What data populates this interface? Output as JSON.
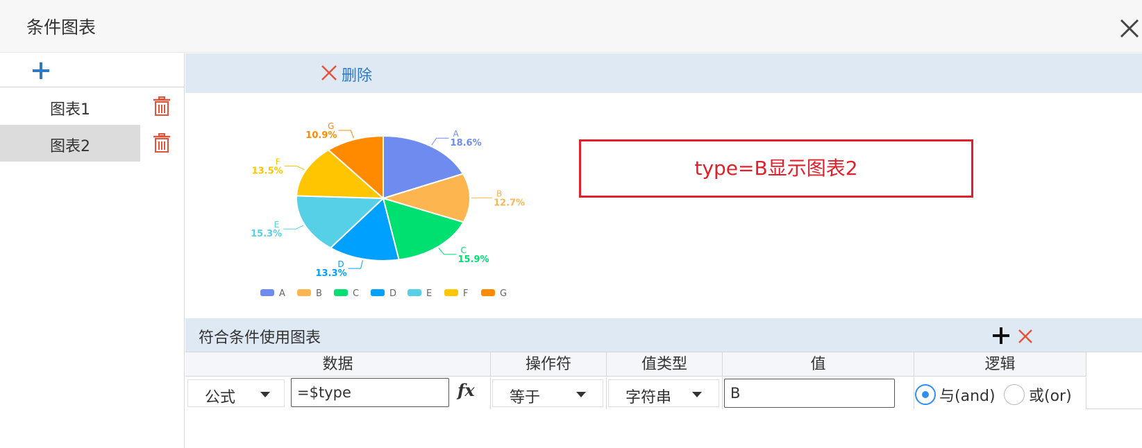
{
  "window": {
    "title": "条件图表"
  },
  "sidebar": {
    "items": [
      {
        "label": "图表1",
        "selected": false
      },
      {
        "label": "图表2",
        "selected": true
      }
    ]
  },
  "toolbar": {
    "delete_label": "删除"
  },
  "note": {
    "text": "type=B显示图表2"
  },
  "chart_data": {
    "type": "pie",
    "categories": [
      "A",
      "B",
      "C",
      "D",
      "E",
      "F",
      "G"
    ],
    "values": [
      18.6,
      12.7,
      15.9,
      13.3,
      15.3,
      13.5,
      10.9
    ],
    "labels": [
      "18.6%",
      "12.7%",
      "15.9%",
      "13.3%",
      "15.3%",
      "13.5%",
      "10.9%"
    ],
    "colors": [
      "#6e8cf0",
      "#fdb64f",
      "#00e070",
      "#00a0ff",
      "#55d0e6",
      "#ffc500",
      "#ff8a00"
    ],
    "legend_position": "bottom"
  },
  "conditions": {
    "title": "符合条件使用图表",
    "columns": [
      "数据",
      "操作符",
      "值类型",
      "值",
      "逻辑"
    ],
    "row": {
      "data_type": "公式",
      "data_value": "=$type",
      "operator": "等于",
      "value_type": "字符串",
      "value": "B",
      "logic_and": "与(and)",
      "logic_or": "或(or)",
      "logic_selected": "and"
    }
  },
  "icons": {
    "close": "close-icon",
    "add": "plus-icon",
    "trash": "trash-icon",
    "delete": "x-icon",
    "formula": "fx-icon",
    "caret": "chevron-down-icon"
  },
  "colors": {
    "accent": "#2e78c4",
    "danger": "#e0202a",
    "toolbar_bg": "#dfe9f3",
    "selected_bg": "#dcdcdc"
  }
}
